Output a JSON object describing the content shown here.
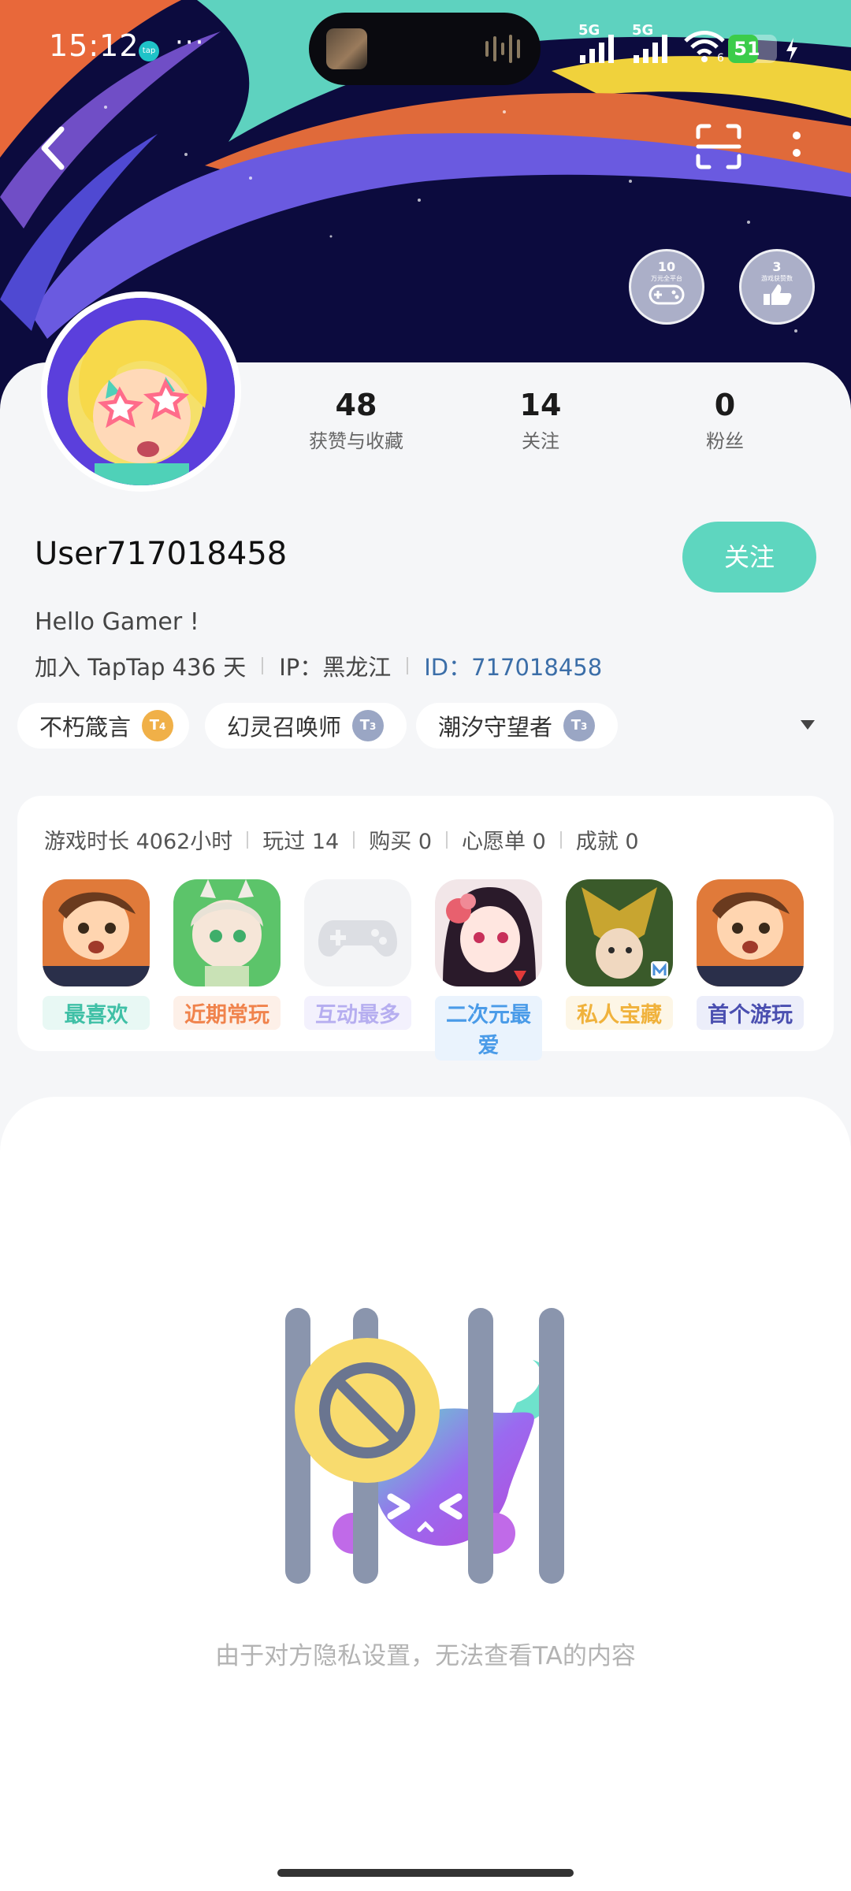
{
  "status_bar": {
    "time": "15:12",
    "app_icon": "taptap-icon",
    "more": "···",
    "network": [
      "5G",
      "5G"
    ],
    "wifi_label": "6",
    "battery": "51"
  },
  "header": {
    "badges": [
      {
        "number": "10",
        "caption": "万元全平台"
      },
      {
        "number": "3",
        "caption": "游戏获赞数"
      }
    ]
  },
  "profile": {
    "stats": [
      {
        "value": "48",
        "label": "获赞与收藏"
      },
      {
        "value": "14",
        "label": "关注"
      },
      {
        "value": "0",
        "label": "粉丝"
      }
    ],
    "username": "User717018458",
    "follow_label": "关注",
    "bio": "Hello Gamer !",
    "joined": "加入 TapTap 436 天",
    "ip": "IP：黑龙江",
    "id": "ID：717018458",
    "tags": [
      {
        "label": "不朽箴言",
        "level": "4"
      },
      {
        "label": "幻灵召唤师",
        "level": "3"
      },
      {
        "label": "潮汐守望者",
        "level": "3"
      }
    ]
  },
  "games": {
    "stats": [
      "游戏时长 4062小时",
      "玩过 14",
      "购买 0",
      "心愿单 0",
      "成就 0"
    ],
    "items": [
      {
        "label": "最喜欢",
        "color": "#3fc0a6",
        "bg": "#e8f8f4"
      },
      {
        "label": "近期常玩",
        "color": "#f0834c",
        "bg": "#fdf0e8"
      },
      {
        "label": "互动最多",
        "color": "#b6aef0",
        "bg": "#f3f1fd"
      },
      {
        "label": "二次元最爱",
        "color": "#4a9be8",
        "bg": "#eaf3fd"
      },
      {
        "label": "私人宝藏",
        "color": "#f0b23c",
        "bg": "#fdf6e6"
      },
      {
        "label": "首个游玩",
        "color": "#4a4fb0",
        "bg": "#eceefa"
      }
    ]
  },
  "privacy": {
    "message": "由于对方隐私设置，无法查看TA的内容"
  }
}
